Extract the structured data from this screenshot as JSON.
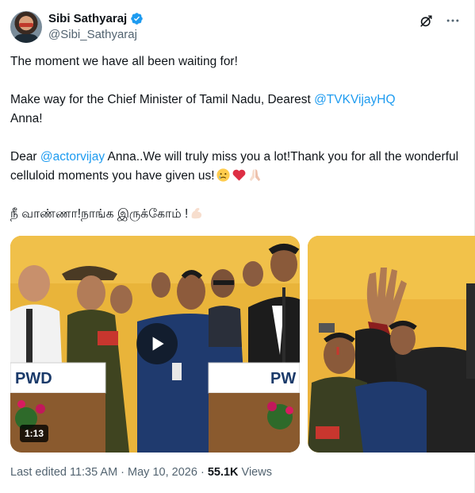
{
  "author": {
    "display_name": "Sibi Sathyaraj",
    "handle": "@Sibi_Sathyaraj"
  },
  "header_icons": [
    "grok-icon",
    "more-icon"
  ],
  "tweet": {
    "line1": "The moment we have all been waiting for!",
    "line2_pre": "Make way for the Chief Minister of Tamil Nadu, Dearest ",
    "line2_mention": "@TVKVijayHQ",
    "line2_post": "Anna!",
    "line3_pre": "Dear ",
    "line3_mention": "@actorvijay",
    "line3_post": " Anna..We will truly miss you a lot!Thank you for all the wonderful celluloid moments you have given us!",
    "line3_emojis": [
      "crying-face-emoji",
      "red-heart-emoji",
      "folded-hands-emoji"
    ],
    "line4": "நீ வாண்ணா!நாங்க இருக்கோம் !",
    "line4_emoji": "flexed-biceps-emoji"
  },
  "media": {
    "video1": {
      "duration": "1:13",
      "podium_text": "PWD"
    },
    "video2": {}
  },
  "footer": {
    "edited": "Last edited 11:35 AM · May 10, 2026",
    "separator": " · ",
    "views_count": "55.1K",
    "views_label": " Views"
  },
  "colors": {
    "accent": "#1d9bf0",
    "text": "#0f1419",
    "muted": "#536471"
  }
}
